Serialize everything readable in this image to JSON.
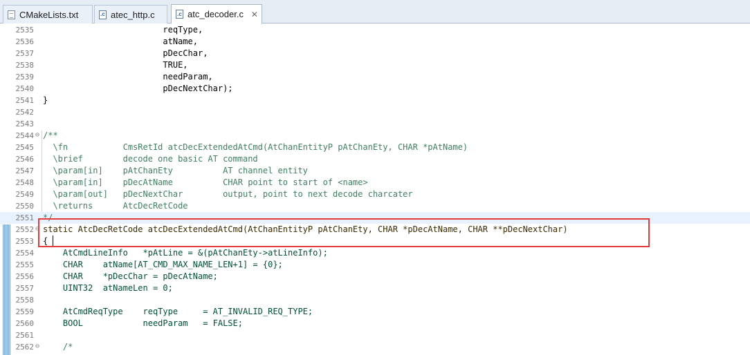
{
  "tabs": [
    {
      "label": "CMakeLists.txt",
      "icon": "text-file-icon"
    },
    {
      "label": "atec_http.c",
      "icon": "c-file-icon"
    },
    {
      "label": "atc_decoder.c",
      "icon": "c-file-icon",
      "active": true,
      "close": "✕"
    }
  ],
  "lines": [
    {
      "n": "2535",
      "t": "                        reqType,"
    },
    {
      "n": "2536",
      "t": "                        atName,"
    },
    {
      "n": "2537",
      "t": "                        pDecChar,"
    },
    {
      "n": "2538",
      "t": "                        TRUE,"
    },
    {
      "n": "2539",
      "t": "                        needParam,"
    },
    {
      "n": "2540",
      "t": "                        pDecNextChar);"
    },
    {
      "n": "2541",
      "t": "}"
    },
    {
      "n": "2542",
      "t": ""
    },
    {
      "n": "2543",
      "t": ""
    },
    {
      "n": "2544",
      "t": "/**"
    },
    {
      "n": "2545",
      "t": "  \\fn           CmsRetId atcDecExtendedAtCmd(AtChanEntityP pAtChanEty, CHAR *pAtName)"
    },
    {
      "n": "2546",
      "t": "  \\brief        decode one basic AT command"
    },
    {
      "n": "2547",
      "t": "  \\param[in]    pAtChanEty          AT channel entity"
    },
    {
      "n": "2548",
      "t": "  \\param[in]    pDecAtName          CHAR point to start of <name>"
    },
    {
      "n": "2549",
      "t": "  \\param[out]   pDecNextChar        output, point to next decode charcater"
    },
    {
      "n": "2550",
      "t": "  \\returns      AtcDecRetCode"
    },
    {
      "n": "2551",
      "t": "*/"
    },
    {
      "n": "2552",
      "t": "static AtcDecRetCode atcDecExtendedAtCmd(AtChanEntityP pAtChanEty, CHAR *pDecAtName, CHAR **pDecNextChar)"
    },
    {
      "n": "2553",
      "t": "{"
    },
    {
      "n": "2554",
      "t": "    AtCmdLineInfo   *pAtLine = &(pAtChanEty->atLineInfo);"
    },
    {
      "n": "2555",
      "t": "    CHAR    atName[AT_CMD_MAX_NAME_LEN+1] = {0};"
    },
    {
      "n": "2556",
      "t": "    CHAR    *pDecChar = pDecAtName;"
    },
    {
      "n": "2557",
      "t": "    UINT32  atNameLen = 0;"
    },
    {
      "n": "2558",
      "t": ""
    },
    {
      "n": "2559",
      "t": "    AtCmdReqType    reqType     = AT_INVALID_REQ_TYPE;"
    },
    {
      "n": "2560",
      "t": "    BOOL            needParam   = FALSE;"
    },
    {
      "n": "2561",
      "t": ""
    },
    {
      "n": "2562",
      "t": "    /*"
    }
  ],
  "colors": {
    "keyword": "#7f0055",
    "comment": "#3f7f5f",
    "macro": "#0000c0",
    "highlight_box": "#e53a3a"
  }
}
